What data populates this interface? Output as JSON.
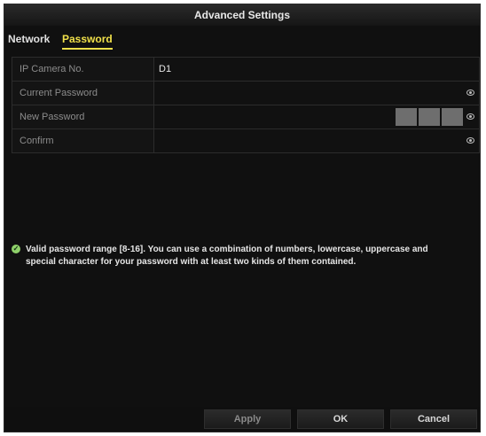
{
  "window": {
    "title": "Advanced Settings"
  },
  "tabs": [
    {
      "label": "Network"
    },
    {
      "label": "Password",
      "active": true
    }
  ],
  "form": {
    "rows": [
      {
        "label": "IP Camera No.",
        "value": "D1"
      },
      {
        "label": "Current Password",
        "value": ""
      },
      {
        "label": "New Password",
        "value": ""
      },
      {
        "label": "Confirm",
        "value": ""
      }
    ],
    "new_password_strength_segments": 3
  },
  "tip": {
    "text": "Valid password range [8-16]. You can use a combination of numbers, lowercase, uppercase and special character for your password with at least two kinds of them contained."
  },
  "buttons": {
    "apply": "Apply",
    "ok": "OK",
    "cancel": "Cancel"
  },
  "colors": {
    "accent": "#f0e04a",
    "tip_icon": "#8fd16a",
    "background": "#101010"
  }
}
